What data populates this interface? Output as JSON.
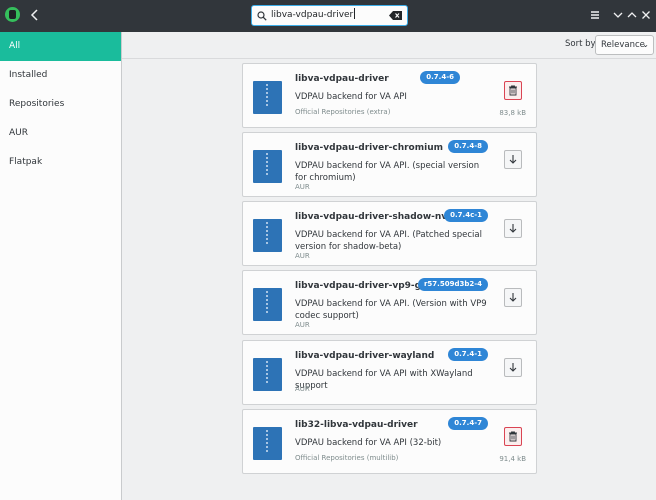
{
  "header": {
    "search_value": "libva-vdpau-driver",
    "icons": [
      "pamac-logo-icon",
      "back-arrow-icon",
      "search-icon",
      "clear-text-icon",
      "hamburger-menu-icon",
      "minimize-icon",
      "maximize-icon",
      "close-icon"
    ]
  },
  "sidebar": {
    "items": [
      {
        "label": "All",
        "selected": true
      },
      {
        "label": "Installed"
      },
      {
        "label": "Repositories"
      },
      {
        "label": "AUR"
      },
      {
        "label": "Flatpak"
      }
    ]
  },
  "sort": {
    "label": "Sort by",
    "value": "Relevance"
  },
  "packages": [
    {
      "name": "libva-vdpau-driver",
      "version": "0.7.4-6",
      "description": "VDPAU backend for VA API",
      "source": "Official Repositories (extra)",
      "size": "83,8 kB",
      "action": "remove"
    },
    {
      "name": "libva-vdpau-driver-chromium",
      "version": "0.7.4-8",
      "description": "VDPAU backend for VA API. (special version for chromium)",
      "source": "AUR",
      "size": "",
      "action": "install"
    },
    {
      "name": "libva-vdpau-driver-shadow-nvidia",
      "version": "0.7.4c-1",
      "description": "VDPAU backend for VA API. (Patched special version for shadow-beta)",
      "source": "AUR",
      "size": "",
      "action": "install"
    },
    {
      "name": "libva-vdpau-driver-vp9-git",
      "version": "r57.509d3b2-4",
      "description": "VDPAU backend for VA API. (Version with VP9 codec support)",
      "source": "AUR",
      "size": "",
      "action": "install"
    },
    {
      "name": "libva-vdpau-driver-wayland",
      "version": "0.7.4-1",
      "description": "VDPAU backend for VA API with XWayland support",
      "source": "AUR",
      "size": "",
      "action": "install"
    },
    {
      "name": "lib32-libva-vdpau-driver",
      "version": "0.7.4-7",
      "description": "VDPAU backend for VA API (32-bit)",
      "source": "Official Repositories (multilib)",
      "size": "91,4 kB",
      "action": "remove"
    }
  ],
  "colors": {
    "accent": "#1abc9c",
    "version_badge": "#2f86d6",
    "remove": "#da4453",
    "titlebar": "#31363b"
  }
}
